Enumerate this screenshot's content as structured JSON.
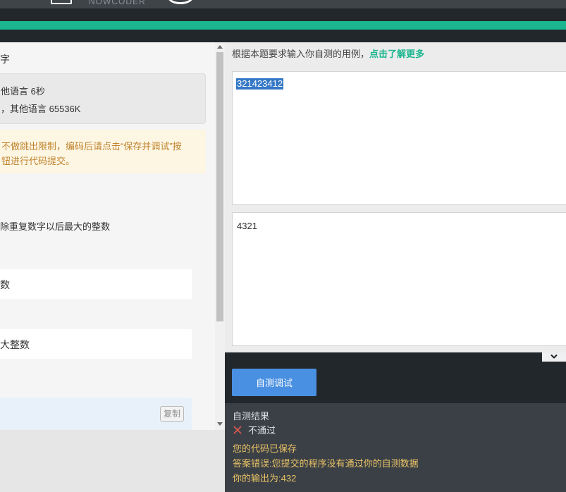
{
  "header": {
    "logo_text": "NOWCODER"
  },
  "problem": {
    "title_fragment": "字",
    "limits": {
      "time": "他语言 6秒",
      "memory": "，其他语言 65536K"
    },
    "notice": {
      "line1": "不做跳出限制，编码后请点击“保存并调试”按",
      "line2": "钮进行代码提交。"
    },
    "description": "除重复数字以后最大的整数",
    "input_desc": "数",
    "output_desc": "大整数",
    "copy_label": "复制"
  },
  "selftest": {
    "hint": "根据本题要求输入你自测的用例，",
    "hint_link": "点击了解更多",
    "input_value": "321423412",
    "expected_output": "4321",
    "run_button": "自测调试"
  },
  "result": {
    "title": "自测结果",
    "status": "不通过",
    "saved": "您的代码已保存",
    "error": "答案错误:您提交的程序没有通过你的自测数据",
    "output": "你的输出为:432"
  },
  "colors": {
    "accent": "#1bb68f",
    "button": "#4a90e2",
    "warning_text": "#e9c266",
    "fail_icon": "#e05a4f"
  }
}
